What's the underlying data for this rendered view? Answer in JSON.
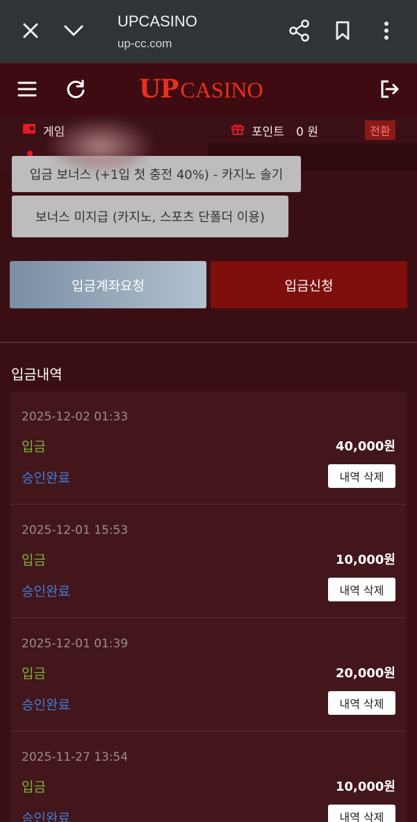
{
  "browser": {
    "title": "UPCASINO",
    "url": "up-cc.com"
  },
  "header": {
    "logo_up": "UP",
    "logo_casino": "CASINO"
  },
  "info": {
    "game_label": "게임",
    "point_label": "포인트",
    "point_value": "0 원",
    "switch_label": "전환"
  },
  "bonus": {
    "option1": "입금 보너스 (+1입 첫 충전 40%) - 카지노 솔기",
    "option2": "보너스 미지급 (카지노, 스포츠 단폴더 이용)"
  },
  "actions": {
    "request_account": "입금계좌요청",
    "apply": "입금신청"
  },
  "history": {
    "title": "입금내역",
    "items": [
      {
        "date": "2025-12-02 01:33",
        "type": "입금",
        "amount": "40,000원",
        "status": "승인완료",
        "delete": "내역 삭제"
      },
      {
        "date": "2025-12-01 15:53",
        "type": "입금",
        "amount": "10,000원",
        "status": "승인완료",
        "delete": "내역 삭제"
      },
      {
        "date": "2025-12-01 01:39",
        "type": "입금",
        "amount": "20,000원",
        "status": "승인완료",
        "delete": "내역 삭제"
      },
      {
        "date": "2025-11-27 13:54",
        "type": "입금",
        "amount": "10,000원",
        "status": "승인완료",
        "delete": "내역 삭제"
      }
    ]
  },
  "colors": {
    "brand": "#e8301c",
    "deposit_type": "#7bb33a",
    "status_approved": "#3f7fd8",
    "apply_button": "#7e0f0c"
  }
}
